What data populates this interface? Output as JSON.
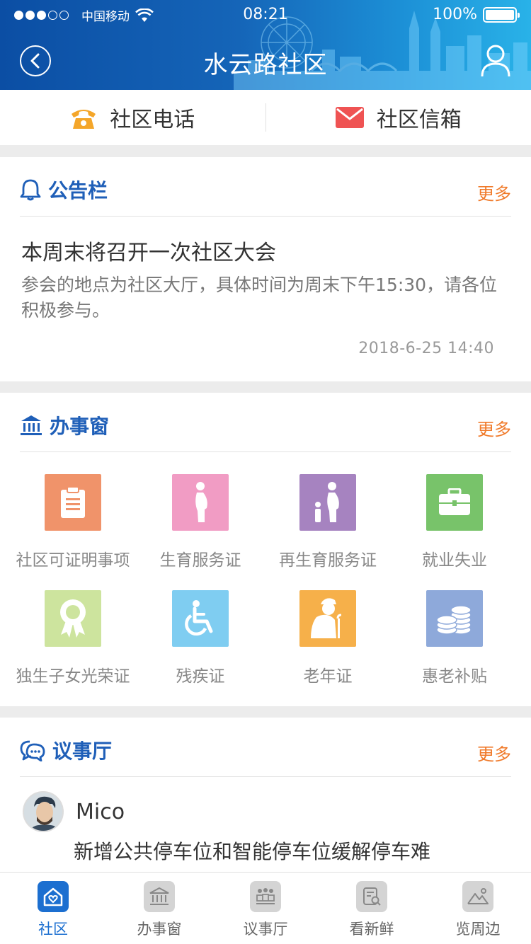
{
  "status_bar": {
    "carrier": "中国移动",
    "time": "08:21",
    "battery": "100%",
    "battery_level": 1.0,
    "signal_bars": 3
  },
  "nav": {
    "title": "水云路社区"
  },
  "contact": {
    "phone_label": "社区电话",
    "mailbox_label": "社区信箱"
  },
  "notice": {
    "section_title": "公告栏",
    "more": "更多",
    "title": "本周末将召开一次社区大会",
    "body": "参会的地点为社区大厅，具体时间为周末下午15:30，请各位积极参与。",
    "time": "2018-6-25  14:40"
  },
  "services": {
    "section_title": "办事窗",
    "more": "更多",
    "items": [
      {
        "label": "社区可证明事项",
        "icon": "clipboard-icon",
        "color": "#f0936a"
      },
      {
        "label": "生育服务证",
        "icon": "pregnant-icon",
        "color": "#f19cc4"
      },
      {
        "label": "再生育服务证",
        "icon": "mother-child-icon",
        "color": "#a683c0"
      },
      {
        "label": "就业失业",
        "icon": "briefcase-icon",
        "color": "#78c36a"
      },
      {
        "label": "独生子女光荣证",
        "icon": "award-icon",
        "color": "#cde49e"
      },
      {
        "label": "残疾证",
        "icon": "wheelchair-icon",
        "color": "#7fcdf1"
      },
      {
        "label": "老年证",
        "icon": "elderly-icon",
        "color": "#f6b04a"
      },
      {
        "label": "惠老补贴",
        "icon": "coins-icon",
        "color": "#8ea9da"
      }
    ]
  },
  "forum": {
    "section_title": "议事厅",
    "more": "更多",
    "post": {
      "user": "Mico",
      "text": "新增公共停车位和智能停车位缓解停车难"
    }
  },
  "tabs": [
    {
      "label": "社区",
      "icon": "home-heart-icon",
      "active": true
    },
    {
      "label": "办事窗",
      "icon": "bank-icon",
      "active": false
    },
    {
      "label": "议事厅",
      "icon": "meeting-icon",
      "active": false
    },
    {
      "label": "看新鲜",
      "icon": "news-search-icon",
      "active": false
    },
    {
      "label": "览周边",
      "icon": "landscape-icon",
      "active": false
    }
  ],
  "colors": {
    "primary": "#1c6fd0",
    "accent_orange": "#f07a2a",
    "phone_icon": "#f4a62a",
    "mail_icon": "#ef5353"
  }
}
